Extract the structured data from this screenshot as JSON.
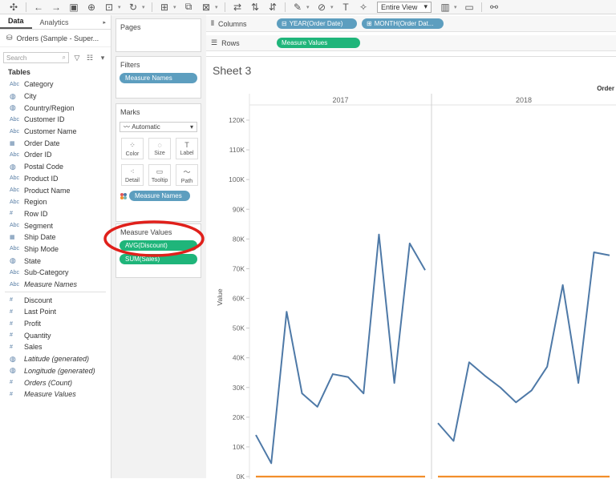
{
  "toolbar": {
    "icons": [
      "tableau-logo-icon",
      "undo-icon",
      "redo-icon",
      "save-icon",
      "new-datasource-icon",
      "pause-icon",
      "refresh-icon",
      "new-worksheet-icon",
      "duplicate-icon",
      "clear-icon",
      "swap-icon",
      "sort-ascending-icon",
      "sort-descending-icon",
      "highlight-icon",
      "group-icon",
      "label-icon",
      "pin-icon",
      "fit-icon",
      "presentation-icon",
      "share-icon"
    ],
    "fit_label": "Entire View"
  },
  "data_pane": {
    "tabs": [
      "Data",
      "Analytics"
    ],
    "datasource": "Orders (Sample - Super...",
    "search_placeholder": "Search",
    "tables_heading": "Tables",
    "dimensions": [
      {
        "type": "Abc",
        "label": "Category"
      },
      {
        "type": "globe",
        "label": "City"
      },
      {
        "type": "globe",
        "label": "Country/Region"
      },
      {
        "type": "Abc",
        "label": "Customer ID"
      },
      {
        "type": "Abc",
        "label": "Customer Name"
      },
      {
        "type": "date",
        "label": "Order Date"
      },
      {
        "type": "Abc",
        "label": "Order ID"
      },
      {
        "type": "globe",
        "label": "Postal Code"
      },
      {
        "type": "Abc",
        "label": "Product ID"
      },
      {
        "type": "Abc",
        "label": "Product Name"
      },
      {
        "type": "Abc",
        "label": "Region"
      },
      {
        "type": "#",
        "label": "Row ID"
      },
      {
        "type": "Abc",
        "label": "Segment"
      },
      {
        "type": "date",
        "label": "Ship Date"
      },
      {
        "type": "Abc",
        "label": "Ship Mode"
      },
      {
        "type": "globe",
        "label": "State"
      },
      {
        "type": "Abc",
        "label": "Sub-Category"
      },
      {
        "type": "Abc",
        "label": "Measure Names",
        "italic": true
      }
    ],
    "measures": [
      {
        "type": "#",
        "label": "Discount"
      },
      {
        "type": "#",
        "label": "Last Point"
      },
      {
        "type": "#",
        "label": "Profit"
      },
      {
        "type": "#",
        "label": "Quantity"
      },
      {
        "type": "#",
        "label": "Sales"
      },
      {
        "type": "globe",
        "label": "Latitude (generated)",
        "italic": true
      },
      {
        "type": "globe",
        "label": "Longitude (generated)",
        "italic": true
      },
      {
        "type": "#",
        "label": "Orders (Count)",
        "italic": true
      },
      {
        "type": "#",
        "label": "Measure Values",
        "italic": true
      }
    ]
  },
  "pages": {
    "title": "Pages"
  },
  "filters": {
    "title": "Filters",
    "pill": "Measure Names"
  },
  "marks": {
    "title": "Marks",
    "type": "Automatic",
    "buttons": [
      "Color",
      "Size",
      "Label",
      "Detail",
      "Tooltip",
      "Path"
    ],
    "pill": "Measure Names"
  },
  "measure_values": {
    "title": "Measure Values",
    "pills": [
      "AVG(Discount)",
      "SUM(Sales)"
    ]
  },
  "columns": {
    "label": "Columns",
    "pills": [
      "YEAR(Order Date)",
      "MONTH(Order Dat..."
    ]
  },
  "rows": {
    "label": "Rows",
    "pills": [
      "Measure Values"
    ]
  },
  "sheet": {
    "title": "Sheet 3",
    "legend_stub": "Order"
  },
  "colors": {
    "line_sales": "#4e79a7",
    "line_discount": "#f28e2b",
    "annotation": "#e0201b",
    "pill_blue": "#5d9ebf",
    "pill_green": "#1fb57a"
  },
  "chart_data": {
    "type": "line",
    "title": "Sheet 3",
    "ylabel": "Value",
    "ylim": [
      0,
      120000
    ],
    "yticks": [
      "0K",
      "10K",
      "20K",
      "30K",
      "40K",
      "50K",
      "60K",
      "70K",
      "80K",
      "90K",
      "100K",
      "110K",
      "120K"
    ],
    "panes": [
      "2017",
      "2018"
    ],
    "series": [
      {
        "name": "SUM(Sales)",
        "values_2017": [
          14000,
          4500,
          55500,
          28000,
          23500,
          34500,
          33500,
          28000,
          81500,
          31500,
          78500,
          69500
        ],
        "values_2018": [
          18000,
          12000,
          38500,
          34000,
          30000,
          25000,
          29000,
          37000,
          64500,
          31500,
          75500,
          74500
        ]
      },
      {
        "name": "AVG(Discount)",
        "values_2017": [
          0.15,
          0.15,
          0.15,
          0.15,
          0.15,
          0.15,
          0.15,
          0.15,
          0.15,
          0.15,
          0.15,
          0.15
        ],
        "values_2018": [
          0.15,
          0.15,
          0.15,
          0.15,
          0.15,
          0.15,
          0.15,
          0.15,
          0.15,
          0.15,
          0.15,
          0.15
        ]
      }
    ]
  }
}
